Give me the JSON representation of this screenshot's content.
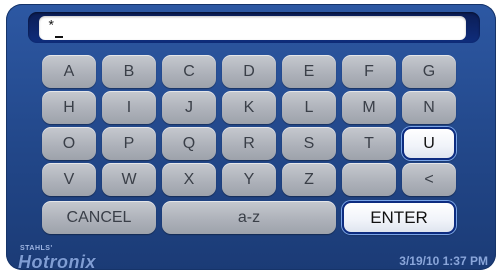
{
  "entry": {
    "text": "*"
  },
  "keyboard": {
    "row1": [
      "A",
      "B",
      "C",
      "D",
      "E",
      "F",
      "G"
    ],
    "row2": [
      "H",
      "I",
      "J",
      "K",
      "L",
      "M",
      "N"
    ],
    "row3": [
      "O",
      "P",
      "Q",
      "R",
      "S",
      "T",
      "U"
    ],
    "row4": [
      "V",
      "W",
      "X",
      "Y",
      "Z",
      "",
      "<"
    ],
    "cancel_label": "CANCEL",
    "case_toggle_label": "a-z",
    "enter_label": "ENTER",
    "highlighted_key": "U"
  },
  "footer": {
    "brand_small": "STAHLS'",
    "brand": "Hotronix",
    "datetime": "3/19/10  1:37 PM"
  },
  "colors": {
    "panel_blue": "#224789",
    "key_gray": "#aeb2ba",
    "highlight_border": "#0d2c80"
  }
}
